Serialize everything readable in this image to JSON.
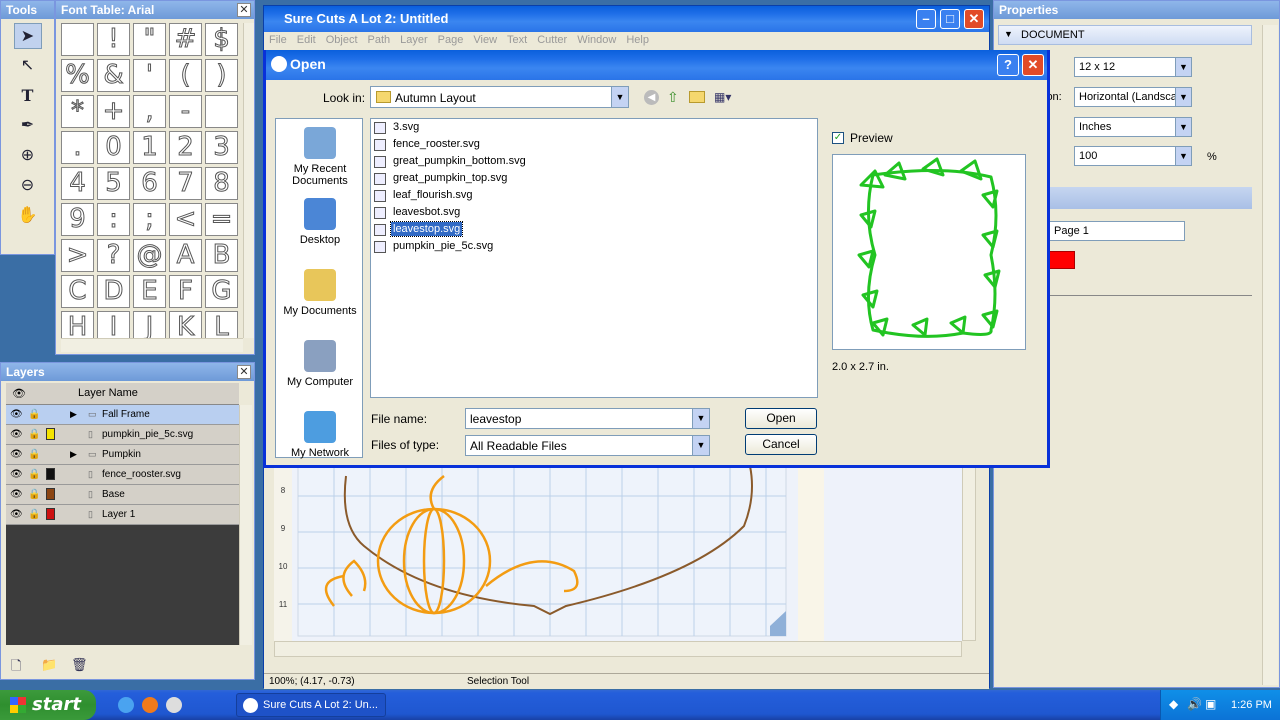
{
  "tools": {
    "title": "Tools",
    "items": [
      "select-tool",
      "node-tool",
      "text-tool",
      "pen-tool",
      "zoom-in-tool",
      "zoom-out-tool",
      "hand-tool"
    ]
  },
  "font_table": {
    "title": "Font Table: Arial",
    "glyphs": [
      "",
      "!",
      "\"",
      "#",
      "$",
      "%",
      "&",
      "'",
      "(",
      ")",
      "*",
      "+",
      ",",
      "-",
      "",
      ".",
      "0",
      "1",
      "2",
      "3",
      "4",
      "5",
      "6",
      "7",
      "8",
      "9",
      ":",
      ";",
      "<",
      "=",
      ">",
      "?",
      "@",
      "A",
      "B",
      "C",
      "D",
      "E",
      "F",
      "G",
      "H",
      "I",
      "J",
      "K",
      "L"
    ]
  },
  "layers": {
    "title": "Layers",
    "header": "Layer Name",
    "rows": [
      {
        "name": "Fall Frame",
        "color": "",
        "expandable": true,
        "selected": true
      },
      {
        "name": "pumpkin_pie_5c.svg",
        "color": "#f4e300",
        "expandable": false,
        "selected": false
      },
      {
        "name": "Pumpkin",
        "color": "",
        "expandable": true,
        "selected": false
      },
      {
        "name": "fence_rooster.svg",
        "color": "#111111",
        "expandable": false,
        "selected": false
      },
      {
        "name": "Base",
        "color": "#8b4513",
        "expandable": false,
        "selected": false
      },
      {
        "name": "Layer 1",
        "color": "#cc1111",
        "expandable": false,
        "selected": false
      }
    ]
  },
  "main_window": {
    "title": "Sure Cuts A Lot 2: Untitled",
    "menu": [
      "File",
      "Edit",
      "Object",
      "Path",
      "Layer",
      "Page",
      "View",
      "Text",
      "Cutter",
      "Window",
      "Help"
    ],
    "ruler_labels": [
      "8",
      "9",
      "10",
      "11"
    ],
    "status_coords": "100%; (4.17, -0.73)",
    "status_tool": "Selection Tool"
  },
  "properties": {
    "title": "Properties",
    "section1": "DOCUMENT",
    "size_value": "12 x 12",
    "orientation_label": "ion:",
    "orientation_value": "Horizontal (Landscap",
    "units_value": "Inches",
    "zoom_value": "100",
    "zoom_unit": "%",
    "page_name": "Page 1",
    "page_color": "#ff0000"
  },
  "dialog": {
    "title": "Open",
    "look_in_label": "Look in:",
    "look_in_value": "Autumn Layout",
    "places": [
      "My Recent Documents",
      "Desktop",
      "My Documents",
      "My Computer",
      "My Network"
    ],
    "files": [
      "3.svg",
      "fence_rooster.svg",
      "great_pumpkin_bottom.svg",
      "great_pumpkin_top.svg",
      "leaf_flourish.svg",
      "leavesbot.svg",
      "leavestop.svg",
      "pumpkin_pie_5c.svg"
    ],
    "selected_index": 6,
    "preview_label": "Preview",
    "preview_checked": true,
    "preview_size": "2.0 x 2.7 in.",
    "file_name_label": "File name:",
    "file_name_value": "leavestop",
    "file_type_label": "Files of type:",
    "file_type_value": "All Readable Files",
    "open_button": "Open",
    "cancel_button": "Cancel"
  },
  "taskbar": {
    "start": "start",
    "task_item": "Sure Cuts A Lot 2: Un...",
    "clock": "1:26 PM"
  }
}
